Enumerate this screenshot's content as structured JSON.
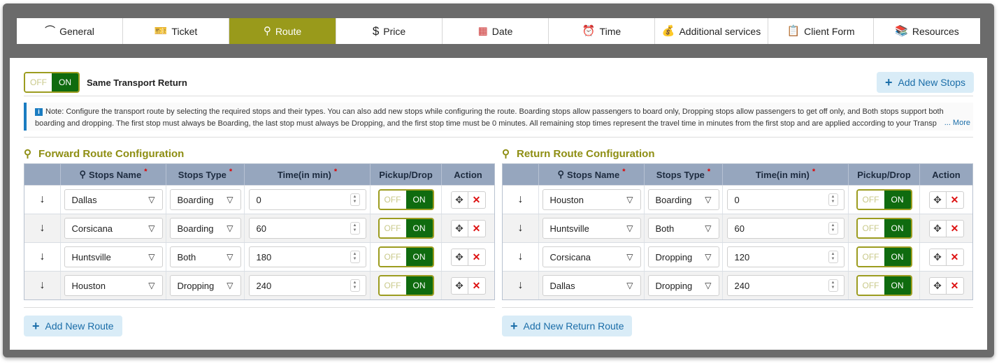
{
  "tabs": [
    {
      "label": "General",
      "icon": "rainbow-icon"
    },
    {
      "label": "Ticket",
      "icon": "ticket-icon"
    },
    {
      "label": "Route",
      "icon": "route-icon",
      "active": true
    },
    {
      "label": "Price",
      "icon": "dollar-icon"
    },
    {
      "label": "Date",
      "icon": "calendar-icon"
    },
    {
      "label": "Time",
      "icon": "alarm-clock-icon"
    },
    {
      "label": "Additional services",
      "icon": "money-bag-icon"
    },
    {
      "label": "Client Form",
      "icon": "clipboard-icon"
    },
    {
      "label": "Resources",
      "icon": "books-icon"
    }
  ],
  "same_transport": {
    "off": "OFF",
    "on": "ON",
    "label": "Same Transport Return"
  },
  "add_new_stops": "Add New Stops",
  "note": {
    "text": "Note: Configure the transport route by selecting the required stops and their types. You can also add new stops while configuring the route. Boarding stops allow passengers to board only, Dropping stops allow passengers to get off only, and Both stops support both boarding and dropping. The first stop must always be Boarding, the last stop must always be Dropping, and the first stop time must be 0 minutes. All remaining stop times represent the travel time in minutes from the first stop and are applied according to your Transp",
    "more": "... More"
  },
  "columns": {
    "stops_name": "Stops Name",
    "stops_type": "Stops Type",
    "time": "Time(in min)",
    "pickup_drop": "Pickup/Drop",
    "action": "Action",
    "required": "*"
  },
  "toggle": {
    "off": "OFF",
    "on": "ON"
  },
  "forward": {
    "title": "Forward Route Configuration",
    "add_button": "Add New Route",
    "rows": [
      {
        "name": "Dallas",
        "type": "Boarding",
        "time": "0"
      },
      {
        "name": "Corsicana",
        "type": "Boarding",
        "time": "60"
      },
      {
        "name": "Huntsville",
        "type": "Both",
        "time": "180"
      },
      {
        "name": "Houston",
        "type": "Dropping",
        "time": "240"
      }
    ]
  },
  "return": {
    "title": "Return Route Configuration",
    "add_button": "Add New Return Route",
    "rows": [
      {
        "name": "Houston",
        "type": "Boarding",
        "time": "0"
      },
      {
        "name": "Huntsville",
        "type": "Both",
        "time": "60"
      },
      {
        "name": "Corsicana",
        "type": "Dropping",
        "time": "120"
      },
      {
        "name": "Dallas",
        "type": "Dropping",
        "time": "240"
      }
    ]
  },
  "colors": {
    "accent": "#999a1b",
    "on_green": "#0f6b0f",
    "link_blue": "#1a6da8",
    "header_bg": "#96a6be"
  }
}
